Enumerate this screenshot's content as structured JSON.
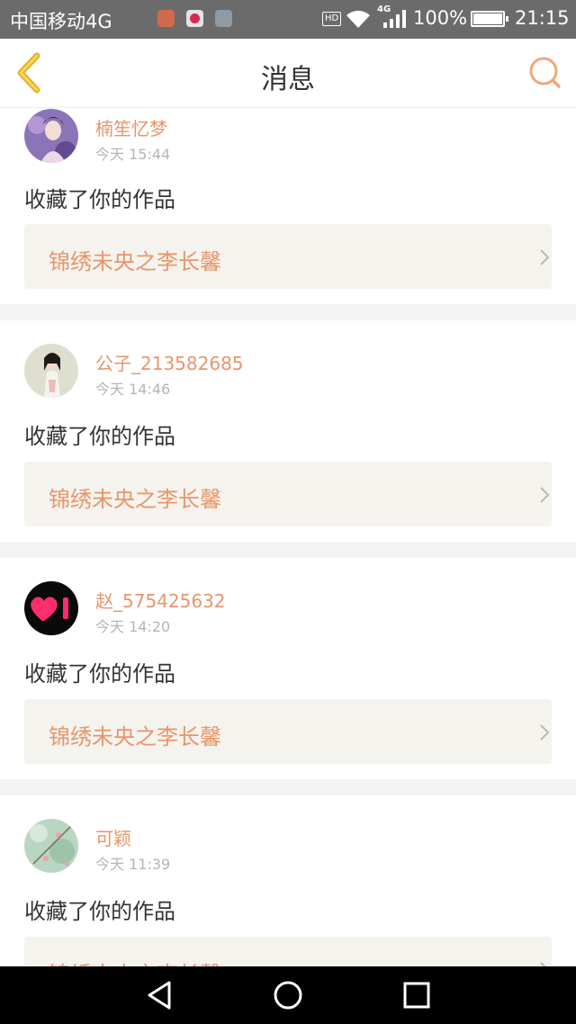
{
  "status_bar": {
    "carrier": "中国移动4G",
    "hd": "HD",
    "network": "4G",
    "battery_percent": "100%",
    "time": "21:15",
    "icons": [
      "app-icon-1",
      "app-icon-2",
      "gallery-icon",
      "wifi-icon",
      "signal-icon",
      "battery-icon"
    ]
  },
  "header": {
    "title": "消息",
    "back_icon": "chevron-left-icon",
    "search_icon": "search-icon"
  },
  "messages": [
    {
      "user": "楠笙忆梦",
      "time": "今天 15:44",
      "text": "收藏了你的作品",
      "work": "锦绣未央之李长馨"
    },
    {
      "user": "公子_213582685",
      "time": "今天 14:46",
      "text": "收藏了你的作品",
      "work": "锦绣未央之李长馨"
    },
    {
      "user": "赵_575425632",
      "time": "今天 14:20",
      "text": "收藏了你的作品",
      "work": "锦绣未央之李长馨"
    },
    {
      "user": "可颖",
      "time": "今天 11:39",
      "text": "收藏了你的作品",
      "work": "锦绣未央之李长馨"
    }
  ],
  "colors": {
    "accent": "#e8956a",
    "back_icon": "#e5b52b",
    "card_bg": "#f4f3ee",
    "separator": "#f3f3f3"
  },
  "nav_bar": {
    "icons": [
      "back-triangle-icon",
      "home-circle-icon",
      "recents-square-icon"
    ]
  }
}
